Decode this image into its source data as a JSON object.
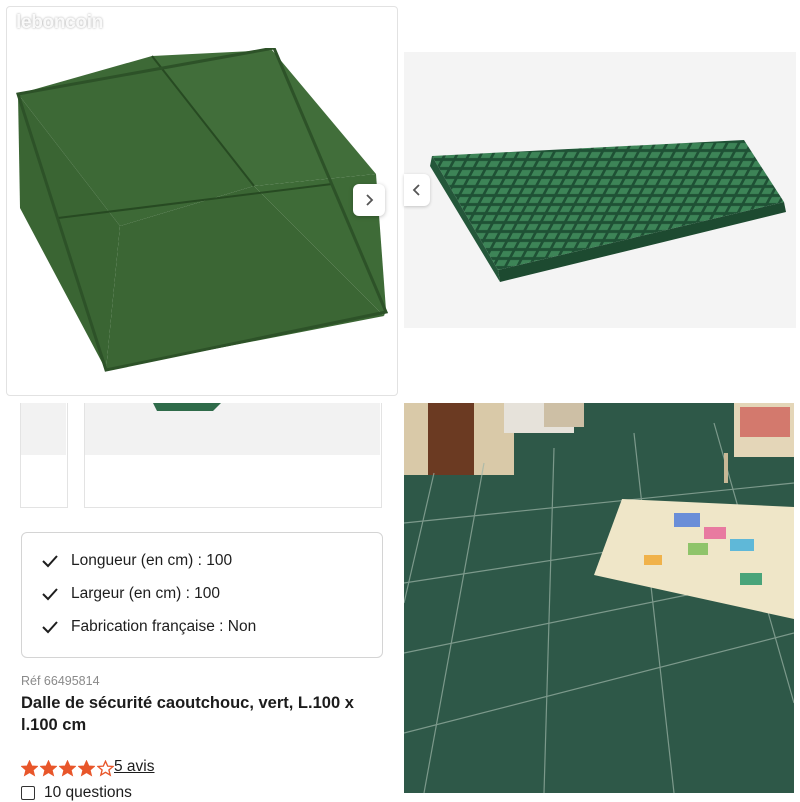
{
  "watermark": "leboncoin",
  "navigation": {
    "next_icon": "chevron-right-icon",
    "prev_icon": "chevron-left-icon"
  },
  "features": [
    {
      "label": "Longueur (en cm) : 100"
    },
    {
      "label": "Largeur (en cm) : 100"
    },
    {
      "label": "Fabrication française : Non"
    }
  ],
  "product": {
    "ref": "Réf 66495814",
    "title_line1": "Dalle de sécurité caoutchouc, vert, L.100 x",
    "title_line2": "l.100 cm",
    "rating": 4,
    "rating_max": 5,
    "reviews": "5 avis",
    "questions": "10 questions"
  },
  "colors": {
    "tile_green": "#3f6a37",
    "mat_green": "#2f6b4a",
    "floor_green": "#2e5848",
    "star": "#e8562a"
  }
}
